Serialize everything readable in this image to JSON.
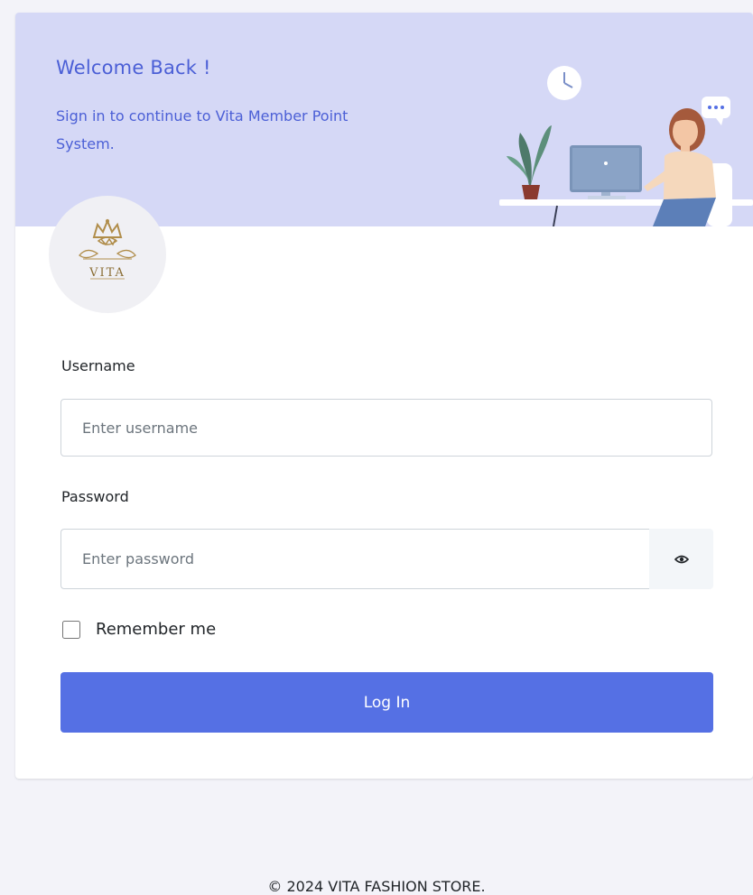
{
  "header": {
    "title": "Welcome Back !",
    "subtitle": "Sign in to continue to Vita Member Point System."
  },
  "logo": {
    "text": "VITA"
  },
  "form": {
    "username_label": "Username",
    "username_placeholder": "Enter username",
    "password_label": "Password",
    "password_placeholder": "Enter password",
    "remember_label": "Remember me",
    "login_label": "Log In"
  },
  "footer": {
    "text": "© 2024 VITA FASHION STORE."
  },
  "colors": {
    "accent": "#5570e4",
    "hero_bg": "#d5d8f6",
    "hero_text": "#4b5fd6"
  },
  "icons": [
    "eye-icon",
    "clock-icon",
    "chat-bubble-icon",
    "plant-icon",
    "monitor-icon"
  ]
}
